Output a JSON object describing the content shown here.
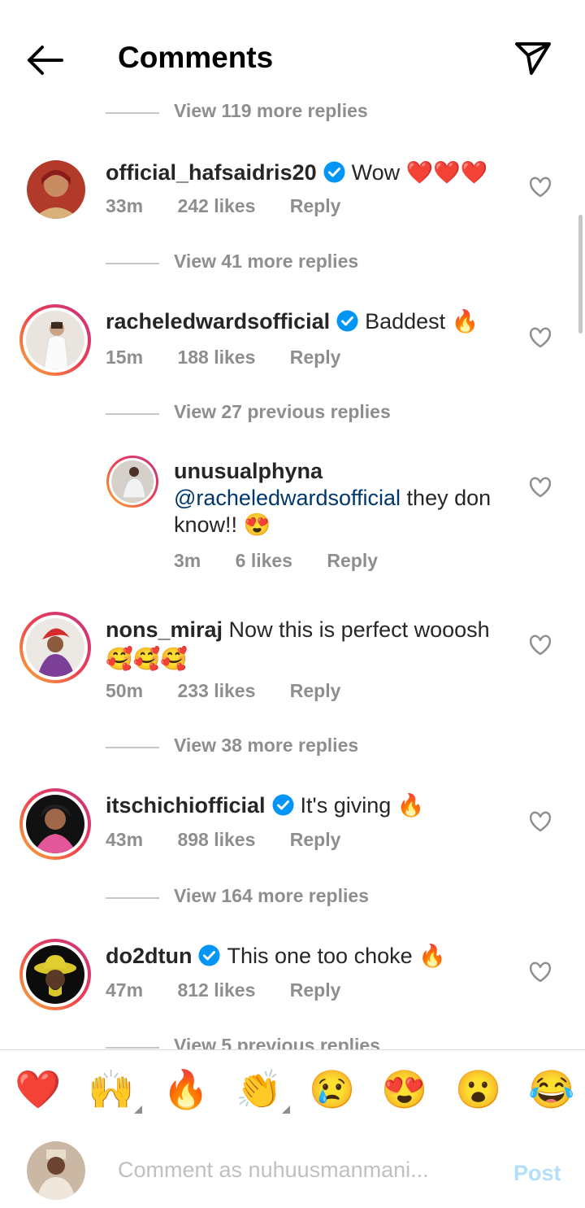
{
  "header": {
    "title": "Comments",
    "back_icon": "arrow-left-icon",
    "share_icon": "paper-plane-icon"
  },
  "view_links": [
    "View 119 more replies",
    "View 41 more replies",
    "View 27 previous replies",
    "View 38 more replies",
    "View 164 more replies",
    "View 5 previous replies"
  ],
  "comments": [
    {
      "user": "official_hafsaidris20",
      "verified": true,
      "text": "Wow ❤️❤️❤️",
      "time": "33m",
      "likes": "242 likes",
      "reply": "Reply"
    },
    {
      "user": "racheledwardsofficial",
      "verified": true,
      "text": "Baddest 🔥",
      "time": "15m",
      "likes": "188 likes",
      "reply": "Reply"
    },
    {
      "user": "unusualphyna",
      "verified": false,
      "mention": "@racheledwardsofficial",
      "text": " they don know!! 😍",
      "time": "3m",
      "likes": "6 likes",
      "reply": "Reply"
    },
    {
      "user": "nons_miraj",
      "verified": false,
      "text": " Now this is perfect wooosh 🥰🥰🥰",
      "time": "50m",
      "likes": "233 likes",
      "reply": "Reply"
    },
    {
      "user": "itschichiofficial",
      "verified": true,
      "text": "It's giving 🔥",
      "time": "43m",
      "likes": "898 likes",
      "reply": "Reply"
    },
    {
      "user": "do2dtun",
      "verified": true,
      "text": "This one too choke 🔥",
      "time": "47m",
      "likes": "812 likes",
      "reply": "Reply"
    }
  ],
  "emoji_bar": [
    "❤️",
    "🙌",
    "🔥",
    "👏",
    "😢",
    "😍",
    "😮",
    "😂"
  ],
  "composer": {
    "placeholder": "Comment as nuhuusmanmani...",
    "post_label": "Post"
  },
  "colors": {
    "accent": "#0095f6",
    "post_disabled": "#b2dffc",
    "verified": "#0095f6",
    "meta": "#8e8e8e"
  }
}
